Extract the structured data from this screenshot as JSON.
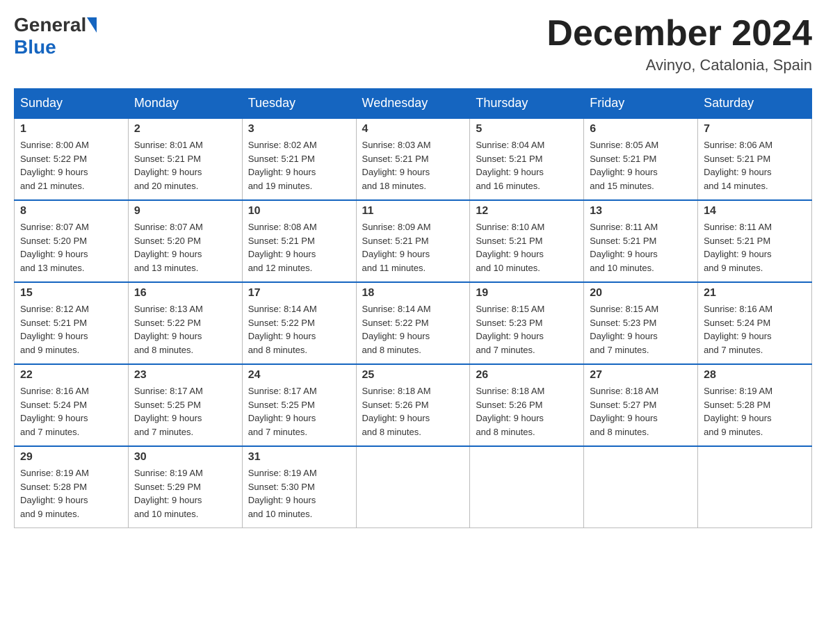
{
  "logo": {
    "general": "General",
    "blue": "Blue"
  },
  "title": "December 2024",
  "location": "Avinyo, Catalonia, Spain",
  "weekdays": [
    "Sunday",
    "Monday",
    "Tuesday",
    "Wednesday",
    "Thursday",
    "Friday",
    "Saturday"
  ],
  "weeks": [
    [
      {
        "day": "1",
        "sunrise": "8:00 AM",
        "sunset": "5:22 PM",
        "daylight": "9 hours and 21 minutes."
      },
      {
        "day": "2",
        "sunrise": "8:01 AM",
        "sunset": "5:21 PM",
        "daylight": "9 hours and 20 minutes."
      },
      {
        "day": "3",
        "sunrise": "8:02 AM",
        "sunset": "5:21 PM",
        "daylight": "9 hours and 19 minutes."
      },
      {
        "day": "4",
        "sunrise": "8:03 AM",
        "sunset": "5:21 PM",
        "daylight": "9 hours and 18 minutes."
      },
      {
        "day": "5",
        "sunrise": "8:04 AM",
        "sunset": "5:21 PM",
        "daylight": "9 hours and 16 minutes."
      },
      {
        "day": "6",
        "sunrise": "8:05 AM",
        "sunset": "5:21 PM",
        "daylight": "9 hours and 15 minutes."
      },
      {
        "day": "7",
        "sunrise": "8:06 AM",
        "sunset": "5:21 PM",
        "daylight": "9 hours and 14 minutes."
      }
    ],
    [
      {
        "day": "8",
        "sunrise": "8:07 AM",
        "sunset": "5:20 PM",
        "daylight": "9 hours and 13 minutes."
      },
      {
        "day": "9",
        "sunrise": "8:07 AM",
        "sunset": "5:20 PM",
        "daylight": "9 hours and 13 minutes."
      },
      {
        "day": "10",
        "sunrise": "8:08 AM",
        "sunset": "5:21 PM",
        "daylight": "9 hours and 12 minutes."
      },
      {
        "day": "11",
        "sunrise": "8:09 AM",
        "sunset": "5:21 PM",
        "daylight": "9 hours and 11 minutes."
      },
      {
        "day": "12",
        "sunrise": "8:10 AM",
        "sunset": "5:21 PM",
        "daylight": "9 hours and 10 minutes."
      },
      {
        "day": "13",
        "sunrise": "8:11 AM",
        "sunset": "5:21 PM",
        "daylight": "9 hours and 10 minutes."
      },
      {
        "day": "14",
        "sunrise": "8:11 AM",
        "sunset": "5:21 PM",
        "daylight": "9 hours and 9 minutes."
      }
    ],
    [
      {
        "day": "15",
        "sunrise": "8:12 AM",
        "sunset": "5:21 PM",
        "daylight": "9 hours and 9 minutes."
      },
      {
        "day": "16",
        "sunrise": "8:13 AM",
        "sunset": "5:22 PM",
        "daylight": "9 hours and 8 minutes."
      },
      {
        "day": "17",
        "sunrise": "8:14 AM",
        "sunset": "5:22 PM",
        "daylight": "9 hours and 8 minutes."
      },
      {
        "day": "18",
        "sunrise": "8:14 AM",
        "sunset": "5:22 PM",
        "daylight": "9 hours and 8 minutes."
      },
      {
        "day": "19",
        "sunrise": "8:15 AM",
        "sunset": "5:23 PM",
        "daylight": "9 hours and 7 minutes."
      },
      {
        "day": "20",
        "sunrise": "8:15 AM",
        "sunset": "5:23 PM",
        "daylight": "9 hours and 7 minutes."
      },
      {
        "day": "21",
        "sunrise": "8:16 AM",
        "sunset": "5:24 PM",
        "daylight": "9 hours and 7 minutes."
      }
    ],
    [
      {
        "day": "22",
        "sunrise": "8:16 AM",
        "sunset": "5:24 PM",
        "daylight": "9 hours and 7 minutes."
      },
      {
        "day": "23",
        "sunrise": "8:17 AM",
        "sunset": "5:25 PM",
        "daylight": "9 hours and 7 minutes."
      },
      {
        "day": "24",
        "sunrise": "8:17 AM",
        "sunset": "5:25 PM",
        "daylight": "9 hours and 7 minutes."
      },
      {
        "day": "25",
        "sunrise": "8:18 AM",
        "sunset": "5:26 PM",
        "daylight": "9 hours and 8 minutes."
      },
      {
        "day": "26",
        "sunrise": "8:18 AM",
        "sunset": "5:26 PM",
        "daylight": "9 hours and 8 minutes."
      },
      {
        "day": "27",
        "sunrise": "8:18 AM",
        "sunset": "5:27 PM",
        "daylight": "9 hours and 8 minutes."
      },
      {
        "day": "28",
        "sunrise": "8:19 AM",
        "sunset": "5:28 PM",
        "daylight": "9 hours and 9 minutes."
      }
    ],
    [
      {
        "day": "29",
        "sunrise": "8:19 AM",
        "sunset": "5:28 PM",
        "daylight": "9 hours and 9 minutes."
      },
      {
        "day": "30",
        "sunrise": "8:19 AM",
        "sunset": "5:29 PM",
        "daylight": "9 hours and 10 minutes."
      },
      {
        "day": "31",
        "sunrise": "8:19 AM",
        "sunset": "5:30 PM",
        "daylight": "9 hours and 10 minutes."
      },
      null,
      null,
      null,
      null
    ]
  ]
}
